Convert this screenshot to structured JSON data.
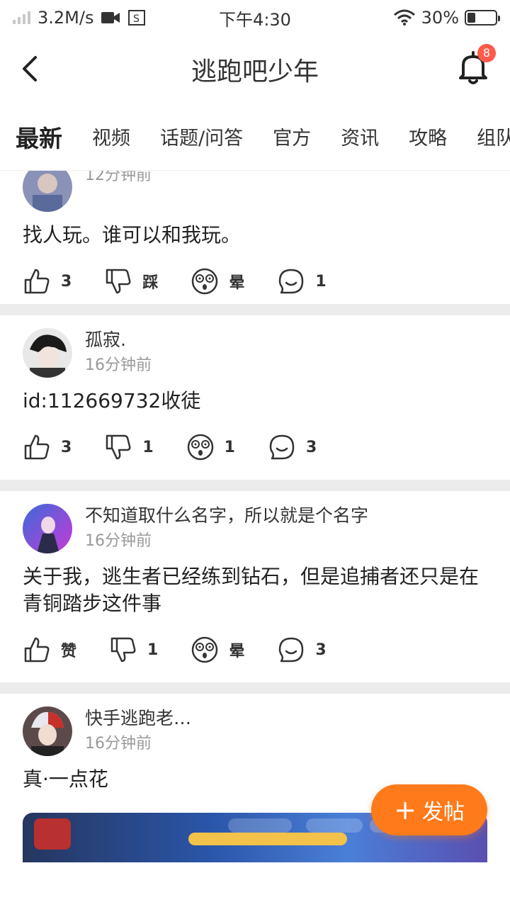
{
  "status_bar": {
    "speed": "3.2M/s",
    "time": "下午4:30",
    "battery": "30%",
    "battery_level": 0.3
  },
  "header": {
    "title": "逃跑吧少年",
    "notification_count": "8"
  },
  "tabs": [
    "最新",
    "视频",
    "话题/问答",
    "官方",
    "资讯",
    "攻略",
    "组队"
  ],
  "posts": [
    {
      "username": "",
      "time": "12分钟前",
      "text": "找人玩。谁可以和我玩。",
      "likes": "3",
      "dislikes": "踩",
      "dizzy": "晕",
      "comments": "1"
    },
    {
      "username": "孤寂.",
      "time": "16分钟前",
      "text": "id:112669732收徒",
      "likes": "3",
      "dislikes": "1",
      "dizzy": "1",
      "comments": "3"
    },
    {
      "username": "不知道取什么名字，所以就是个名字",
      "time": "16分钟前",
      "text": "关于我，逃生者已经练到钻石，但是追捕者还只是在青铜踏步这件事",
      "likes": "赞",
      "dislikes": "1",
      "dizzy": "晕",
      "comments": "3"
    },
    {
      "username": "快手逃跑老…",
      "time": "16分钟前",
      "text": "真·一点花"
    }
  ],
  "fab": {
    "label": "发帖"
  },
  "colors": {
    "accent": "#ff7a1a",
    "badge": "#ff5a4a"
  }
}
